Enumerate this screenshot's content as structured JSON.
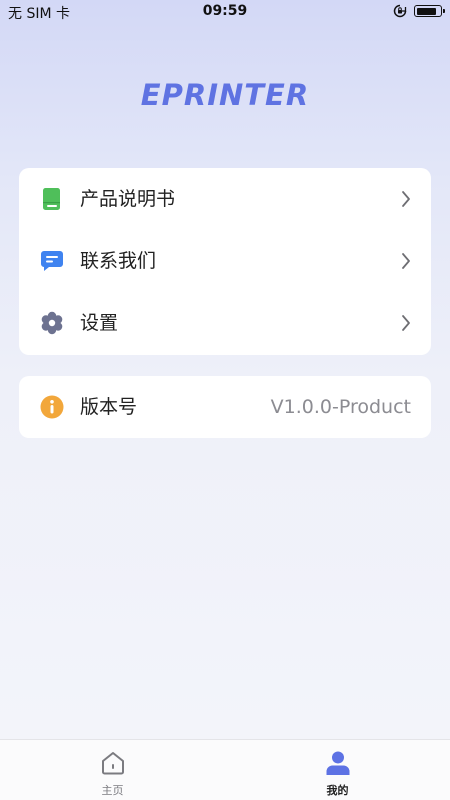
{
  "status_bar": {
    "carrier": "无 SIM 卡",
    "time": "09:59",
    "battery_level": 0.85,
    "icons": [
      "orientation-lock-icon",
      "battery-icon"
    ]
  },
  "logo": {
    "text": "EPRINTER",
    "color": "#5f73e2"
  },
  "menu": {
    "items": [
      {
        "label": "产品说明书",
        "icon": "book-icon",
        "icon_color": "#4fbf5a"
      },
      {
        "label": "联系我们",
        "icon": "message-icon",
        "icon_color": "#3f83f0"
      },
      {
        "label": "设置",
        "icon": "gear-icon",
        "icon_color": "#6d7290"
      }
    ]
  },
  "version": {
    "label": "版本号",
    "value": "V1.0.0-Product",
    "icon": "info-icon",
    "icon_color": "#f2a73b"
  },
  "tab_bar": {
    "tabs": [
      {
        "label": "主页",
        "icon": "home-icon",
        "active": false
      },
      {
        "label": "我的",
        "icon": "user-icon",
        "active": true,
        "color": "#5d72e4"
      }
    ]
  }
}
